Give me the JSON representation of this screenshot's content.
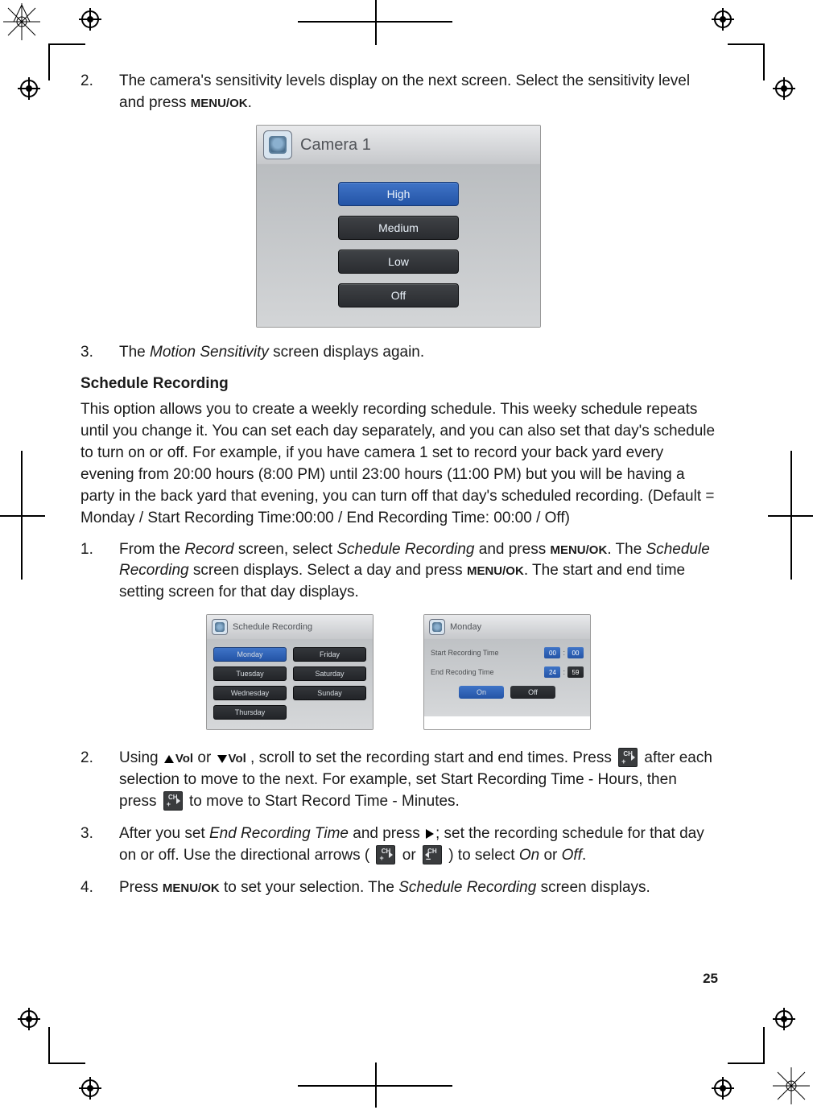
{
  "page_number": "25",
  "step2a": {
    "num": "2.",
    "text_a": "The camera's sensitivity levels display on the next screen. Select the sensitivity level and press ",
    "menuok": "MENU/OK",
    "text_b": "."
  },
  "camera_shot": {
    "title": "Camera 1",
    "options": [
      "High",
      "Medium",
      "Low",
      "Off"
    ],
    "selected_index": 0
  },
  "step3a": {
    "num": "3.",
    "text_a": "The ",
    "ital": "Motion Sensitivity",
    "text_b": " screen displays again."
  },
  "heading": "Schedule Recording",
  "para": "This option allows you to create a weekly recording schedule. This weeky schedule repeats until you change it. You can set each day separately, and you can also set that day's schedule to turn on or off. For example, if you have camera 1 set to record your back yard every evening from 20:00 hours (8:00 PM) until 23:00 hours (11:00 PM) but you will be having a  party in the back yard that evening, you can turn off that day's scheduled recording. (Default =  Monday / Start Recording Time:00:00 / End Recording Time: 00:00 / Off)",
  "step1b": {
    "num": "1.",
    "a": "From the ",
    "i1": "Record",
    "b": " screen, select ",
    "i2": "Schedule Recording",
    "c": " and press ",
    "menuok": "MENU/OK",
    "d": ". The ",
    "i3": "Schedule Recording",
    "e": " screen displays. Select a day and press ",
    "menuok2": "MENU/OK",
    "f": ". The start and end time setting screen for that day displays."
  },
  "mini_left": {
    "title": "Schedule Recording",
    "days_left": [
      "Monday",
      "Tuesday",
      "Wednesday",
      "Thursday"
    ],
    "days_right": [
      "Friday",
      "Saturday",
      "Sunday"
    ],
    "selected": "Monday"
  },
  "mini_right": {
    "title": "Monday",
    "row1_label": "Start Recording Time",
    "row1_h": "00",
    "row1_m": "00",
    "row2_label": "End Recoding Time",
    "row2_h": "24",
    "row2_m": "59",
    "on": "On",
    "off": "Off"
  },
  "step2b": {
    "num": "2.",
    "a": "Using  ",
    "vol": "Vol",
    "b": " or  ",
    "c": " , scroll to set the recording start and end times. Press ",
    "d": "   after each selection to move to the next. For example, set Start Recording Time - Hours, then press  ",
    "e": "   to move to Start Record Time - Minutes."
  },
  "step3b": {
    "num": "3.",
    "a": "After you set ",
    "i1": "End Recording Time",
    "b": " and press  ",
    "c": ";  set the recording schedule for that day on or off. Use the directional arrows ( ",
    "d": "  or ",
    "e": "  ) to select ",
    "i2": "On",
    "f": " or ",
    "i3": "Off",
    "g": "."
  },
  "step4b": {
    "num": "4.",
    "a": "Press ",
    "menuok": "MENU/OK",
    "b": " to set your selection. The ",
    "i1": "Schedule Recording",
    "c": " screen displays."
  },
  "ch_label": "CH"
}
